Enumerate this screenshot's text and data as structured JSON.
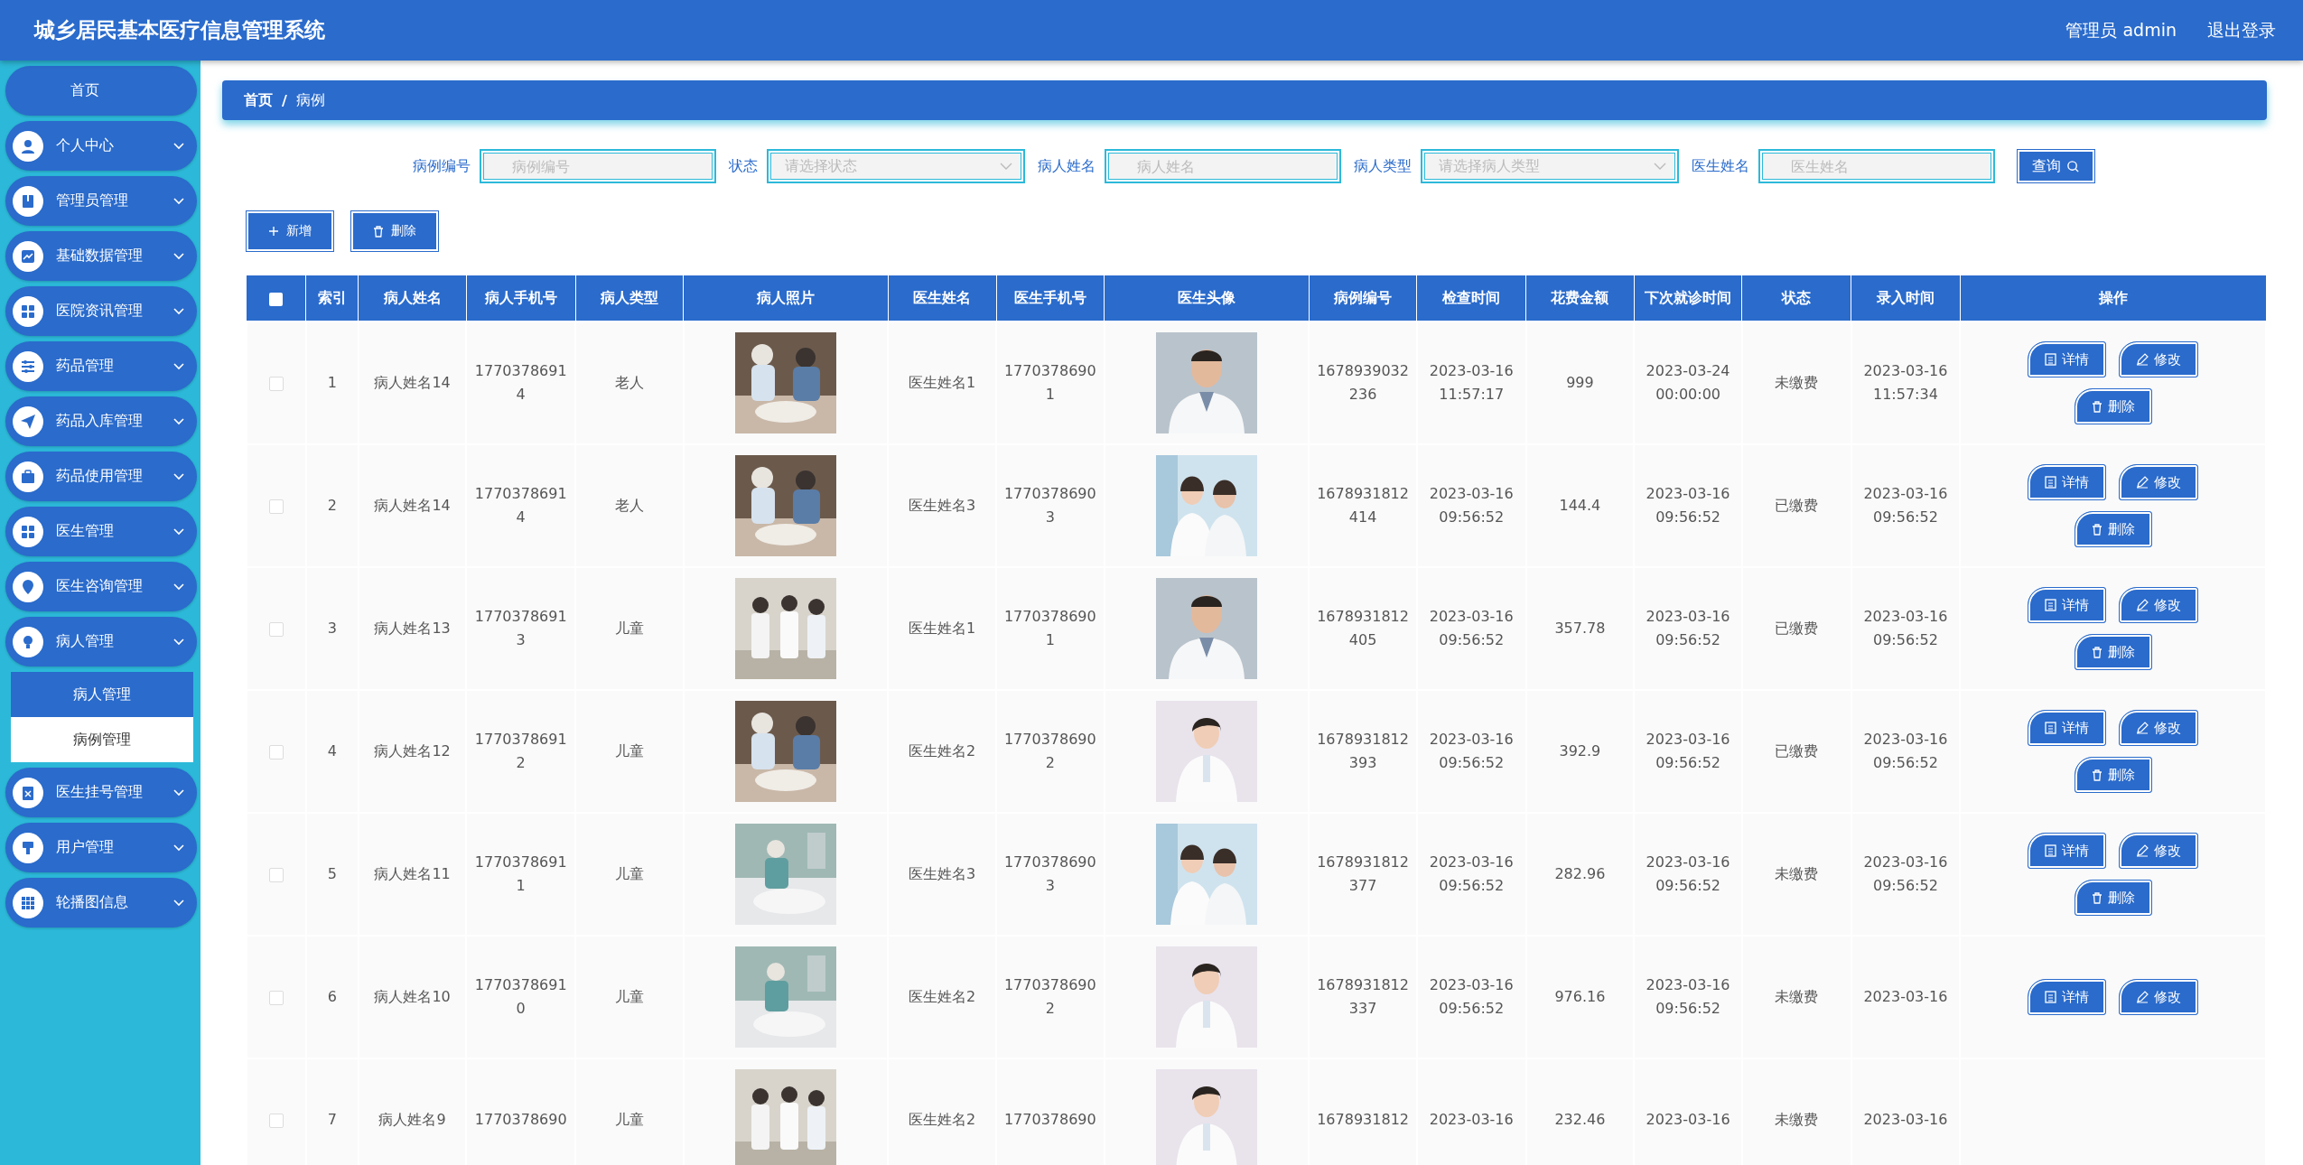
{
  "header": {
    "title": "城乡居民基本医疗信息管理系统",
    "user": "管理员 admin",
    "logout": "退出登录"
  },
  "sidebar": {
    "items": [
      {
        "label": "首页"
      },
      {
        "label": "个人中心"
      },
      {
        "label": "管理员管理"
      },
      {
        "label": "基础数据管理"
      },
      {
        "label": "医院资讯管理"
      },
      {
        "label": "药品管理"
      },
      {
        "label": "药品入库管理"
      },
      {
        "label": "药品使用管理"
      },
      {
        "label": "医生管理"
      },
      {
        "label": "医生咨询管理"
      },
      {
        "label": "病人管理",
        "children": [
          {
            "label": "病人管理",
            "selected": false
          },
          {
            "label": "病例管理",
            "selected": true
          }
        ]
      },
      {
        "label": "医生挂号管理"
      },
      {
        "label": "用户管理"
      },
      {
        "label": "轮播图信息"
      }
    ]
  },
  "breadcrumb": {
    "items": [
      "首页",
      "病例"
    ],
    "separator": "/"
  },
  "search": {
    "fields": [
      {
        "label": "病例编号",
        "kind": "input",
        "placeholder": "病例编号"
      },
      {
        "label": "状态",
        "kind": "select",
        "placeholder": "请选择状态"
      },
      {
        "label": "病人姓名",
        "kind": "input",
        "placeholder": "病人姓名"
      },
      {
        "label": "病人类型",
        "kind": "select",
        "placeholder": "请选择病人类型"
      },
      {
        "label": "医生姓名",
        "kind": "input",
        "placeholder": "医生姓名"
      }
    ],
    "button": "查询"
  },
  "toolbar": [
    {
      "label": "新增",
      "kind": "add"
    },
    {
      "label": "删除",
      "kind": "delete"
    }
  ],
  "table": {
    "header_checkbox": {
      "checked": false
    },
    "columns": [
      "索引",
      "病人姓名",
      "病人手机号",
      "病人类型",
      "病人照片",
      "医生姓名",
      "医生手机号",
      "医生头像",
      "病例编号",
      "检查时间",
      "花费金额",
      "下次就诊时间",
      "状态",
      "录入时间",
      "操作"
    ],
    "rows": [
      {
        "checked": false,
        "index": "1",
        "patient": "病人姓名14",
        "phone": "17703786914",
        "type": "老人",
        "doctor": "医生姓名1",
        "doctor_phone": "17703786901",
        "case_no": "1678939032236",
        "check_time": "2023-03-16 11:57:17",
        "cost": "999",
        "next_visit": "2023-03-24 00:00:00",
        "status": "未缴费",
        "entered": "2023-03-16 11:57:34",
        "actions": [
          "详情",
          "修改",
          "删除"
        ]
      },
      {
        "checked": false,
        "index": "2",
        "patient": "病人姓名14",
        "phone": "17703786914",
        "type": "老人",
        "doctor": "医生姓名3",
        "doctor_phone": "17703786903",
        "case_no": "1678931812414",
        "check_time": "2023-03-16 09:56:52",
        "cost": "144.4",
        "next_visit": "2023-03-16 09:56:52",
        "status": "已缴费",
        "entered": "2023-03-16 09:56:52",
        "actions": [
          "详情",
          "修改",
          "删除"
        ]
      },
      {
        "checked": false,
        "index": "3",
        "patient": "病人姓名13",
        "phone": "17703786913",
        "type": "儿童",
        "doctor": "医生姓名1",
        "doctor_phone": "17703786901",
        "case_no": "1678931812405",
        "check_time": "2023-03-16 09:56:52",
        "cost": "357.78",
        "next_visit": "2023-03-16 09:56:52",
        "status": "已缴费",
        "entered": "2023-03-16 09:56:52",
        "actions": [
          "详情",
          "修改",
          "删除"
        ]
      },
      {
        "checked": false,
        "index": "4",
        "patient": "病人姓名12",
        "phone": "17703786912",
        "type": "儿童",
        "doctor": "医生姓名2",
        "doctor_phone": "17703786902",
        "case_no": "1678931812393",
        "check_time": "2023-03-16 09:56:52",
        "cost": "392.9",
        "next_visit": "2023-03-16 09:56:52",
        "status": "已缴费",
        "entered": "2023-03-16 09:56:52",
        "actions": [
          "详情",
          "修改",
          "删除"
        ]
      },
      {
        "checked": false,
        "index": "5",
        "patient": "病人姓名11",
        "phone": "17703786911",
        "type": "儿童",
        "doctor": "医生姓名3",
        "doctor_phone": "17703786903",
        "case_no": "1678931812377",
        "check_time": "2023-03-16 09:56:52",
        "cost": "282.96",
        "next_visit": "2023-03-16 09:56:52",
        "status": "未缴费",
        "entered": "2023-03-16 09:56:52",
        "actions": [
          "详情",
          "修改",
          "删除"
        ]
      },
      {
        "checked": false,
        "index": "6",
        "patient": "病人姓名10",
        "phone": "17703786910",
        "type": "儿童",
        "doctor": "医生姓名2",
        "doctor_phone": "17703786902",
        "case_no": "1678931812337",
        "check_time": "2023-03-16 09:56:52",
        "cost": "976.16",
        "next_visit": "2023-03-16 09:56:52",
        "status": "未缴费",
        "entered": "2023-03-16",
        "actions": [
          "详情",
          "修改"
        ]
      },
      {
        "checked": false,
        "index": "7",
        "patient": "病人姓名9",
        "phone": "1770378690",
        "type": "儿童",
        "doctor": "医生姓名2",
        "doctor_phone": "1770378690",
        "case_no": "1678931812",
        "check_time": "2023-03-16",
        "cost": "232.46",
        "next_visit": "2023-03-16",
        "status": "未缴费",
        "entered": "2023-03-16",
        "actions": []
      }
    ]
  }
}
